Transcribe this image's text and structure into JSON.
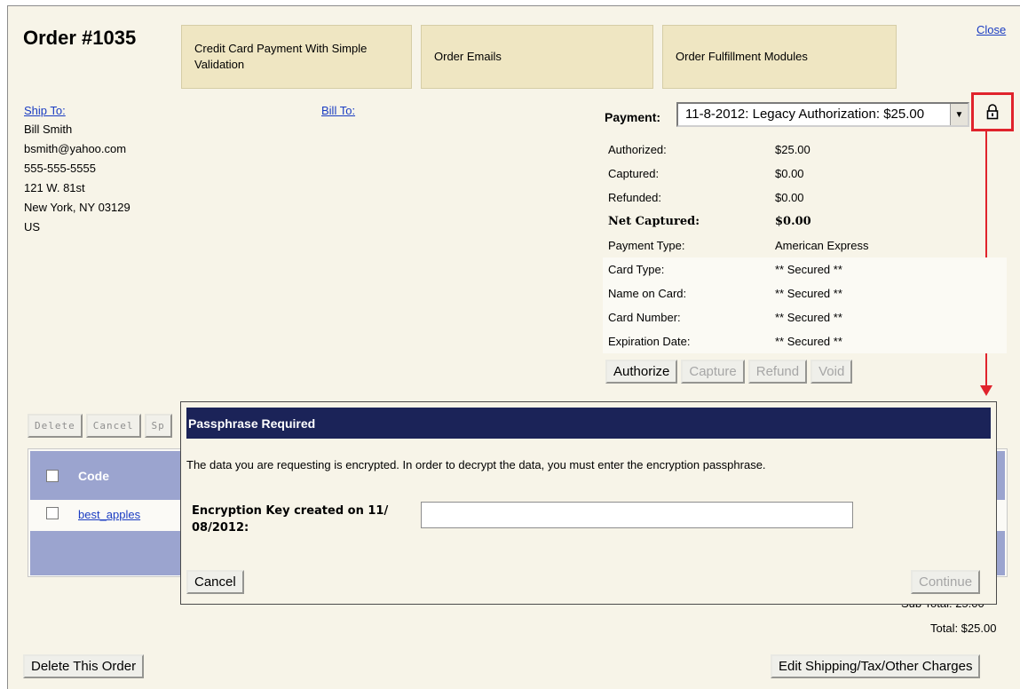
{
  "order": {
    "title": "Order #1035"
  },
  "tabs": [
    {
      "label": "Credit Card Payment With Simple Validation"
    },
    {
      "label": "Order Emails"
    },
    {
      "label": "Order Fulfillment Modules"
    }
  ],
  "close_label": "Close",
  "ship_to": {
    "label": "Ship To:",
    "lines": [
      "Bill Smith",
      "bsmith@yahoo.com",
      "555-555-5555",
      "121 W. 81st",
      "New York, NY 03129",
      "US"
    ]
  },
  "bill_to": {
    "label": "Bill To:"
  },
  "payment": {
    "label": "Payment:",
    "selected": "11-8-2012: Legacy Authorization: $25.00",
    "rows": [
      {
        "key": "Authorized:",
        "value": "$25.00"
      },
      {
        "key": "Captured:",
        "value": "$0.00"
      },
      {
        "key": "Refunded:",
        "value": "$0.00"
      },
      {
        "key": "Net Captured:",
        "value": "$0.00"
      },
      {
        "key": "Payment Type:",
        "value": "American Express"
      },
      {
        "key": "Card Type:",
        "value": "** Secured **"
      },
      {
        "key": "Name on Card:",
        "value": "** Secured **"
      },
      {
        "key": "Card Number:",
        "value": "** Secured **"
      },
      {
        "key": "Expiration Date:",
        "value": "** Secured **"
      }
    ],
    "buttons": {
      "authorize": "Authorize",
      "capture": "Capture",
      "refund": "Refund",
      "void": "Void"
    }
  },
  "items": {
    "action_buttons": {
      "delete": "Delete",
      "cancel": "Cancel",
      "split": "Sp"
    },
    "header": {
      "code": "Code"
    },
    "rows": [
      {
        "code": "best_apples"
      }
    ]
  },
  "totals": {
    "sub_total": "Sub Total:  25.00",
    "total": "Total: $25.00"
  },
  "bottom": {
    "delete_order": "Delete This Order",
    "edit_charges": "Edit Shipping/Tax/Other Charges"
  },
  "modal": {
    "title": "Passphrase Required",
    "message": "The data you are requesting is encrypted. In order to decrypt the data, you must enter the encryption passphrase.",
    "field_label": "Encryption Key created on 11/ 08/2012:",
    "input_value": "",
    "cancel": "Cancel",
    "continue": "Continue"
  },
  "colors": {
    "accent_red": "#e0232c",
    "modal_header": "#1b2358",
    "grid_header": "#9ba4cf",
    "link": "#1a3cc2"
  }
}
